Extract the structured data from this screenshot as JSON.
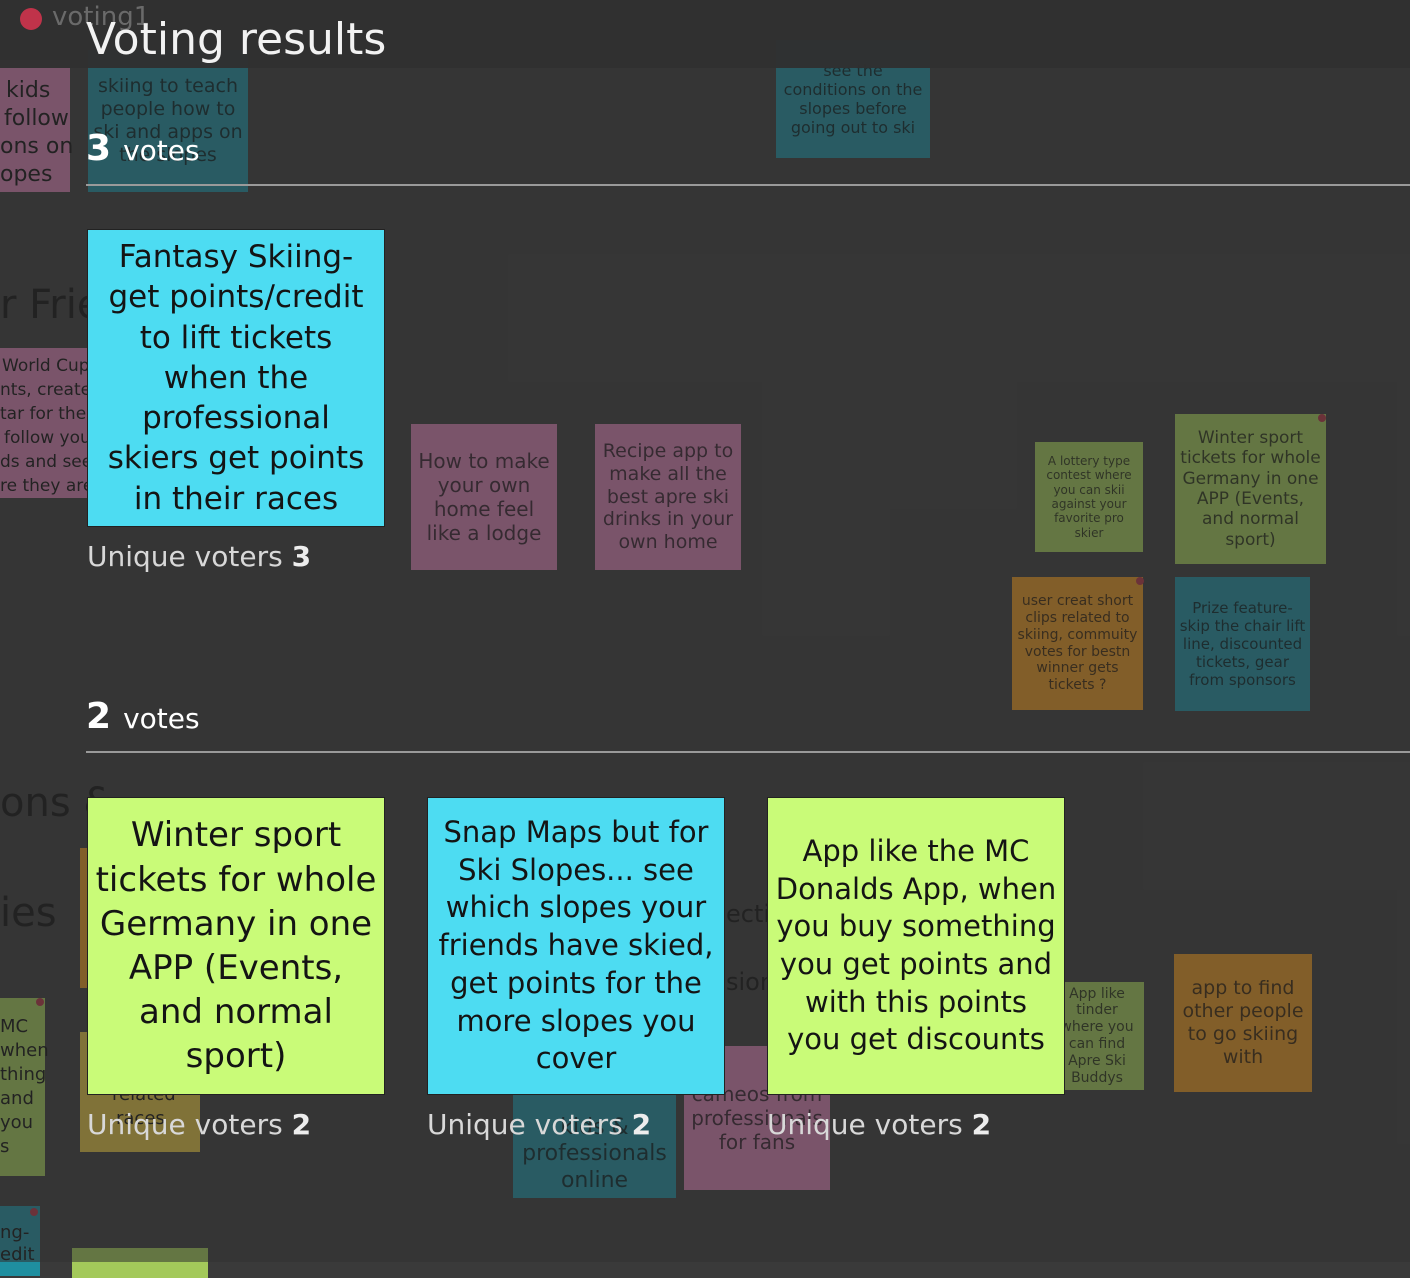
{
  "header": {
    "board_name": "voting1",
    "title": "Voting results"
  },
  "background": {
    "fragments": {
      "f1": "kids",
      "f2": "follow",
      "f3": "ons on",
      "f4": "opes",
      "f5": "r Frie",
      "f6": "World Cup",
      "f7": "nts, create",
      "f8": "tar for the",
      "f9": "follow you",
      "f10": "ds and see",
      "f11": "re they are",
      "f12": "ons &",
      "f13": "ies",
      "f14": "MC",
      "f15": "when",
      "f16": "thing",
      "f17": "and",
      "f18": "you",
      "f19": "s",
      "f20": "ng-",
      "f21": "edit",
      "f22": "related",
      "f23": "races",
      "f24": "ectin",
      "f25": "sion"
    },
    "notes": {
      "skiing_teach": "skiing to teach people how to ski and apps on the slopes",
      "conditions": "see the conditions on the slopes before going out to ski",
      "lodge": "How to make your own home feel like a lodge",
      "recipe": "Recipe app to make all the best apre ski drinks in your own home",
      "lottery": "A lottery type contest where you can skii against your favorite pro skier",
      "winter_small": "Winter sport tickets for whole Germany in one APP (Events, and normal sport)",
      "clips": "user creat short clips related to skiing, commuity votes for bestn winner gets tickets ?",
      "prize": "Prize feature- skip the chair lift line, discounted tickets, gear from sponsors",
      "kids_pros": "kids & professionals online",
      "cameos": "cameos from professionals for fans",
      "tinder": "App like tinder where you can find Apre Ski Buddys",
      "find_people": "app to find other people to go skiing with"
    }
  },
  "groups": [
    {
      "count": "3",
      "label": "votes",
      "ideas": [
        {
          "text": "Fantasy Skiing- get points/credit to lift tickets when the professional skiers get points in their races",
          "color": "#4ddcf2",
          "voters_label": "Unique voters",
          "voters_count": "3"
        }
      ]
    },
    {
      "count": "2",
      "label": "votes",
      "ideas": [
        {
          "text": "Winter sport tickets for whole Germany in one APP (Events, and normal sport)",
          "color": "#c9fb78",
          "voters_label": "Unique voters",
          "voters_count": "2"
        },
        {
          "text": "Snap Maps but for Ski Slopes... see which slopes your friends have skied, get points for the more slopes you cover",
          "color": "#4ddcf2",
          "voters_label": "Unique voters",
          "voters_count": "2"
        },
        {
          "text": "App like the MC Donalds App, when you buy something you get points and with this points you get discounts",
          "color": "#c9fb78",
          "voters_label": "Unique voters",
          "voters_count": "2"
        }
      ]
    }
  ]
}
